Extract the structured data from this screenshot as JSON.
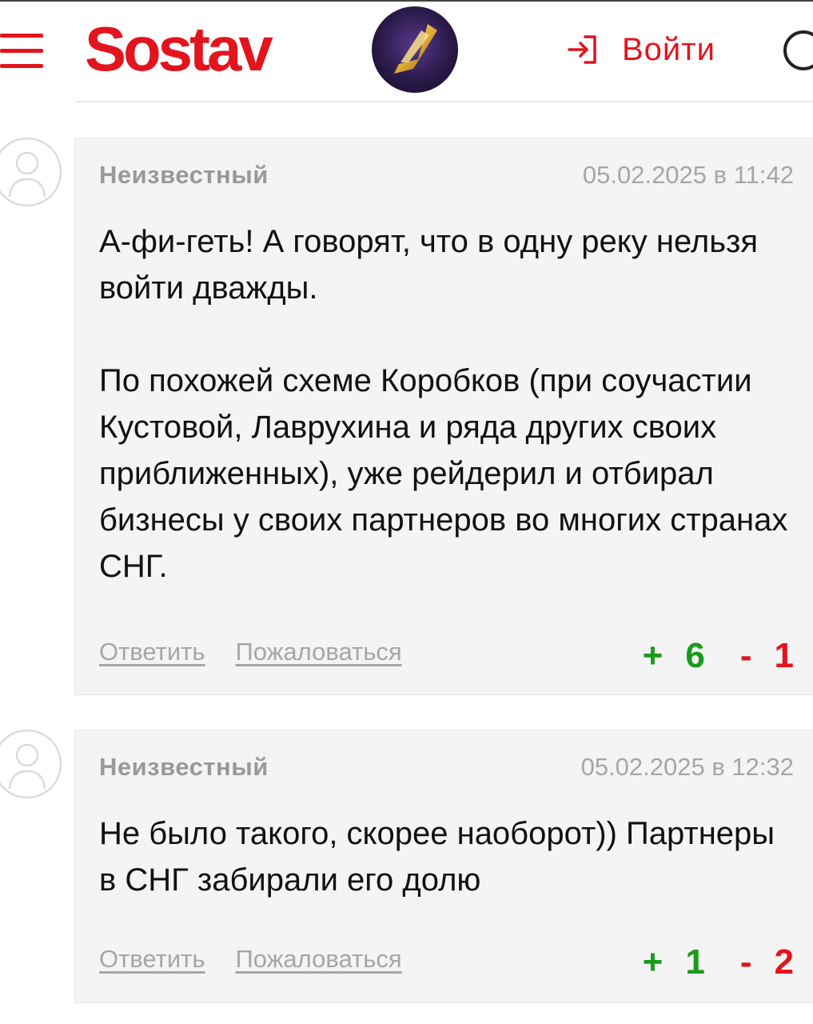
{
  "header": {
    "logo": "Sostav",
    "login_label": "Войти"
  },
  "colors": {
    "brand": "#e3141d",
    "vote_up": "#1b9a1b",
    "vote_down": "#e3141d"
  },
  "comments": [
    {
      "author": "Неизвестный",
      "date": "05.02.2025 в 11:42",
      "paragraphs": [
        "А-фи-геть! А говорят, что в одну реку нельзя войти дважды.",
        "По похожей схеме Коробков (при соучастии Кустовой, Лаврухина и ряда других своих приближенных), уже рейдерил и отбирал бизнесы у своих партнеров во многих странах СНГ."
      ],
      "reply_label": "Ответить",
      "report_label": "Пожаловаться",
      "up_sign": "+",
      "up_count": "6",
      "down_sign": "-",
      "down_count": "1"
    },
    {
      "author": "Неизвестный",
      "date": "05.02.2025 в 12:32",
      "paragraphs": [
        "Не было такого, скорее наоборот)) Партнеры в СНГ забирали его долю"
      ],
      "reply_label": "Ответить",
      "report_label": "Пожаловаться",
      "up_sign": "+",
      "up_count": "1",
      "down_sign": "-",
      "down_count": "2"
    }
  ],
  "icons": {
    "menu": "hamburger-menu-icon",
    "login": "login-arrow-icon",
    "search": "search-icon",
    "user": "user-placeholder-icon"
  }
}
